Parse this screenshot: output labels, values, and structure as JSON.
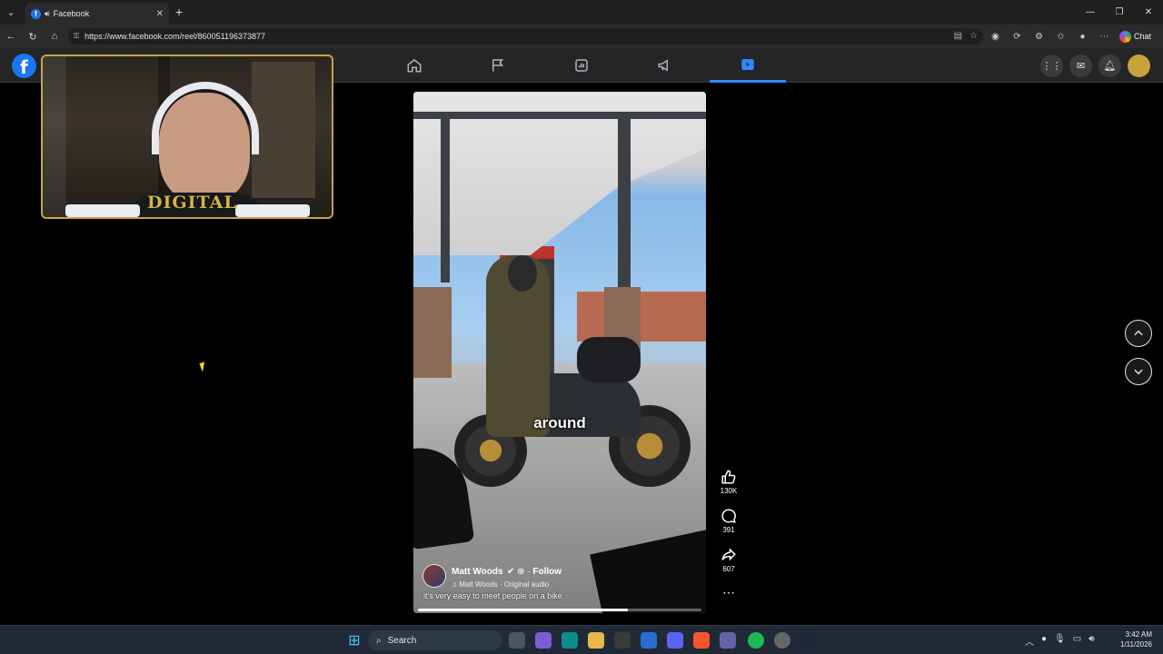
{
  "browser": {
    "tab_title": "Facebook",
    "url": "https://www.facebook.com/reel/860051196373877",
    "chat_label": "Chat"
  },
  "webcam": {
    "brand_text": "DIGITAL"
  },
  "reel": {
    "caption": "around",
    "author": "Matt Woods",
    "follow_label": "Follow",
    "audio": "Matt Woods · Original audio",
    "description": "it's very easy to meet people on a bike",
    "progress_fraction": 0.74,
    "likes": "130K",
    "comments": "391",
    "shares": "607"
  },
  "taskbar": {
    "search_label": "Search",
    "time": "3:42 AM",
    "date": "1/11/2026"
  },
  "colors": {
    "facebook_blue": "#1877f2",
    "active_nav": "#2d88ff"
  },
  "icons": [
    "home-icon",
    "flag-icon",
    "gaming-icon",
    "megaphone-icon",
    "reels-icon",
    "apps-grid-icon",
    "messenger-icon",
    "bell-icon",
    "like-icon",
    "comment-icon",
    "share-icon",
    "more-icon",
    "chevron-up-icon",
    "chevron-down-icon"
  ]
}
